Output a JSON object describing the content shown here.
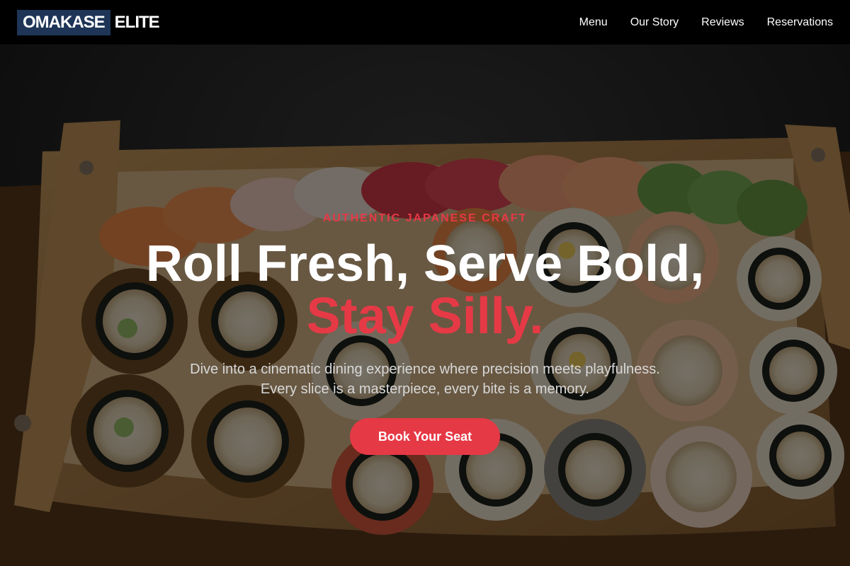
{
  "brand": {
    "name_main": "OMAKASE",
    "name_sub": "ELITE",
    "colors": {
      "accent": "#e63946",
      "logo_bg": "#1e3557",
      "nav_bg": "#000000"
    }
  },
  "nav": {
    "items": [
      {
        "label": "Menu"
      },
      {
        "label": "Our Story"
      },
      {
        "label": "Reviews"
      },
      {
        "label": "Reservations"
      }
    ]
  },
  "hero": {
    "eyebrow": "AUTHENTIC JAPANESE CRAFT",
    "headline_line1": "Roll Fresh, Serve Bold,",
    "headline_line2": "Stay Silly.",
    "subtitle_line1": "Dive into a cinematic dining experience where precision meets playfulness.",
    "subtitle_line2": "Every slice is a masterpiece, every bite is a memory.",
    "cta_label": "Book Your Seat"
  }
}
